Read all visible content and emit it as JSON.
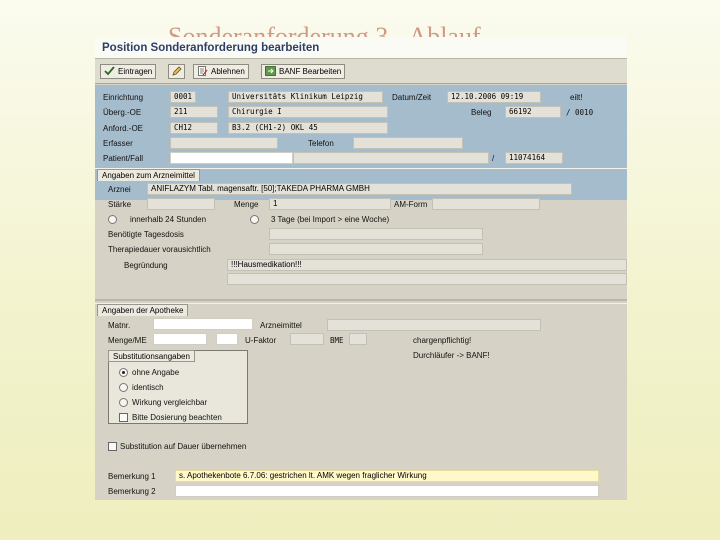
{
  "slide": {
    "title": "Sonderanforderung 3 - Ablauf"
  },
  "window": {
    "title": "Position Sonderanforderung bearbeiten"
  },
  "toolbar": {
    "eintragen": "Eintragen",
    "ablehnen": "Ablehnen",
    "banf": "BANF Bearbeiten"
  },
  "header": {
    "einrichtung_label": "Einrichtung",
    "einrichtung_value": "0001",
    "einrichtung_name": "Universitäts Klinikum Leipzig",
    "datum_label": "Datum/Zeit",
    "datum_value": "12.10.2006 09:19",
    "status": "eilt!",
    "ueberg_label": "Überg.-OE",
    "ueberg_value": "211",
    "ueberg_name": "Chirurgie I",
    "beleg_label": "Beleg",
    "beleg_value": "66192",
    "beleg_pos": "/ 0010",
    "anford_label": "Anford.-OE",
    "anford_value": "CH12",
    "anford_name": "B3.2 (CH1-2) OKL 45",
    "erfasser_label": "Erfasser",
    "erfasser_value": "",
    "telefon_label": "Telefon",
    "telefon_value": "",
    "patient_label": "Patient/Fall",
    "patient_value": "",
    "fall_sep": "/",
    "fall_value": "11074164"
  },
  "arzneimittel": {
    "group_title": "Angaben zum Arzneimittel",
    "arznei_label": "Arznei",
    "arznei_value": "ANIFLAZYM Tabl. magensaftr. [50];TAKEDA PHARMA GMBH",
    "staerke_label": "Stärke",
    "staerke_value": "",
    "menge_label": "Menge",
    "menge_value": "1",
    "amform_label": "AM-Form",
    "amform_value": "",
    "option_24h": "innerhalb 24 Stunden",
    "option_3tage": "3 Tage (bei Import > eine Woche)",
    "tagesdosis_label": "Benötigte Tagesdosis",
    "therapiedauer_label": "Therapiedauer vorausichtlich",
    "begruendung_label": "Begründung",
    "begruendung_value": "!!!Hausmedikation!!!"
  },
  "apotheke": {
    "group_title": "Angaben der Apotheke",
    "matnr_label": "Matnr.",
    "matnr_value": "",
    "arzneimittel_label": "Arzneimittel",
    "arzneimittel_value": "",
    "mengeme_label": "Menge/ME",
    "ufaktor_label": "U-Faktor",
    "bme_label": "BME",
    "chargen_text": "chargenpflichtig!",
    "durchlaeufer_text": "Durchläufer -> BANF!",
    "subst_title": "Substitutionsangaben",
    "subst_options": [
      "ohne Angabe",
      "identisch",
      "Wirkung vergleichbar"
    ],
    "dosierung_label": "Bitte Dosierung beachten",
    "dauer_label": "Substitution auf Dauer übernehmen",
    "bemerkung1_label": "Bemerkung 1",
    "bemerkung1_value": "s. Apothekenbote 6.7.06: gestrichen lt. AMK wegen fraglicher Wirkung",
    "bemerkung2_label": "Bemerkung 2",
    "bemerkung2_value": ""
  }
}
